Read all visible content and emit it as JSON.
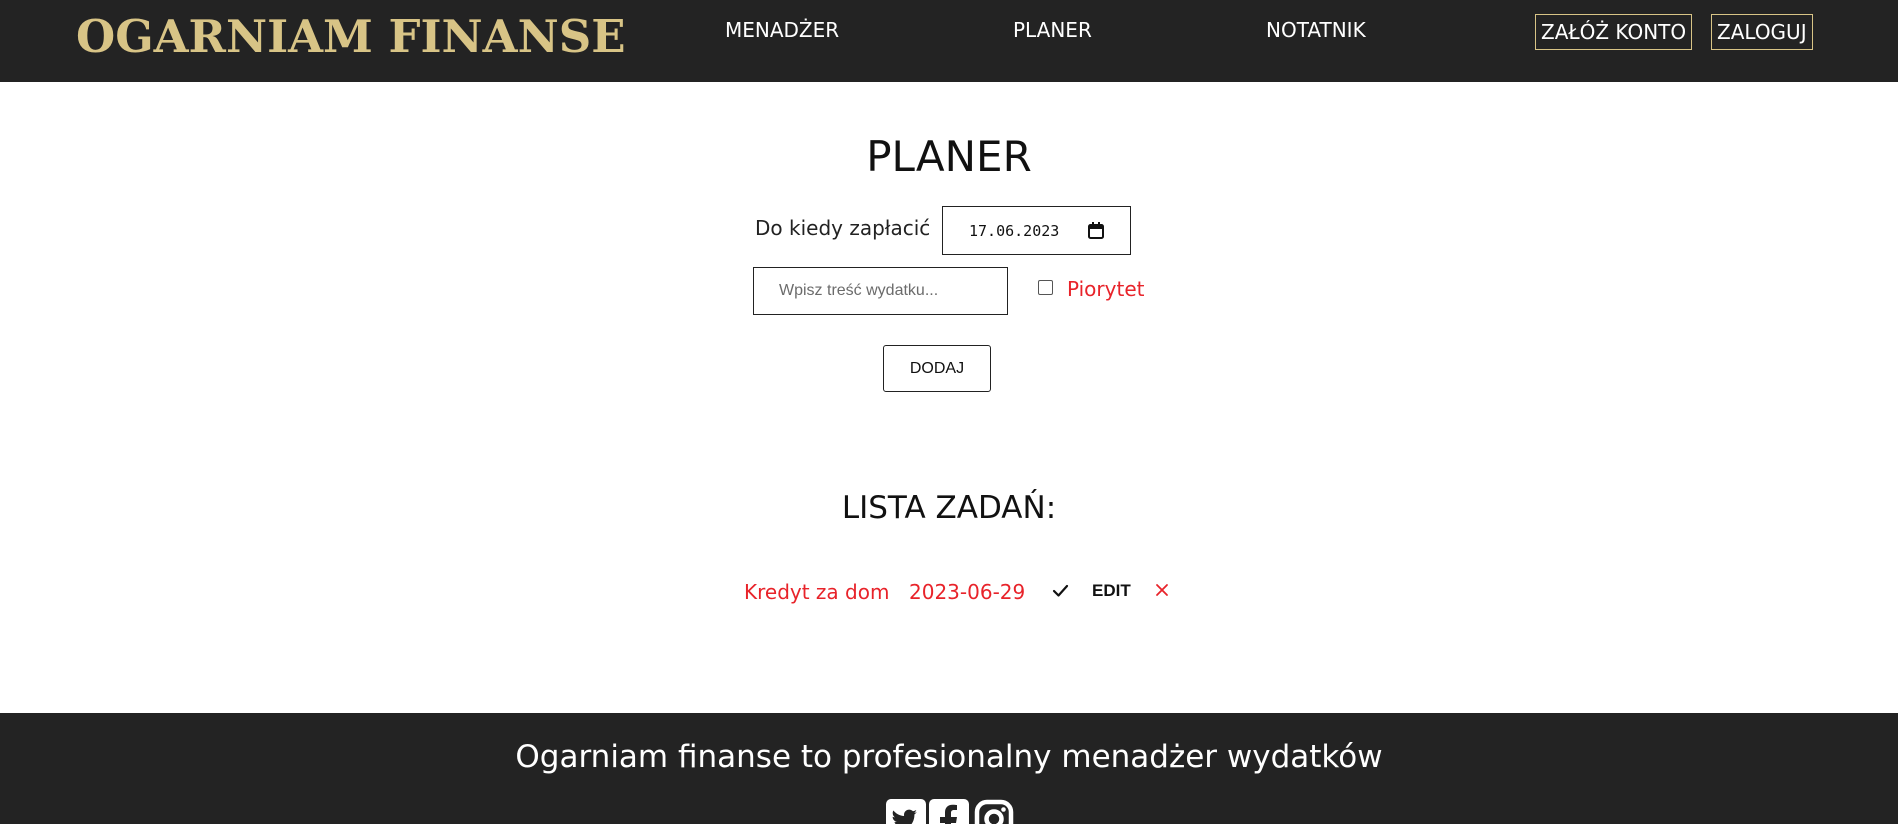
{
  "header": {
    "logo": "OGARNIAM FINANSE",
    "nav": [
      "MENADŻER",
      "PLANER",
      "NOTATNIK"
    ],
    "register_label": "ZAŁÓŻ KONTO",
    "login_label": "ZALOGUJ"
  },
  "main": {
    "title": "PLANER",
    "due_label": "Do kiedy zapłacić",
    "due_date_value": "17.06.2023",
    "expense_placeholder": "Wpisz treść wydatku...",
    "priority_label": "Piorytet",
    "add_label": "DODAJ",
    "list_title": "LISTA ZADAŃ:",
    "tasks": [
      {
        "name": "Kredyt za dom",
        "date": "2023-06-29",
        "edit_label": "EDIT"
      }
    ]
  },
  "footer": {
    "text": "Ogarniam finanse to profesionalny menadżer wydatków",
    "social_icons": [
      "twitter-icon",
      "facebook-icon",
      "instagram-icon"
    ]
  },
  "colors": {
    "header_bg": "#232323",
    "accent_gold": "#d8c486",
    "priority_red": "#e8232a"
  }
}
